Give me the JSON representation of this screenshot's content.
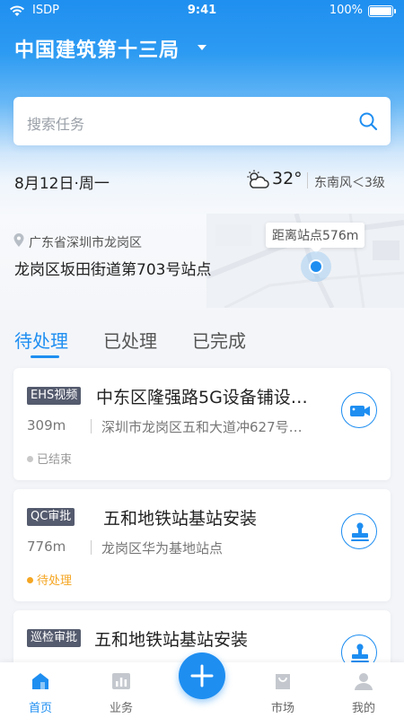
{
  "status_bar": {
    "carrier": "ISDP",
    "time": "9:41",
    "battery": "100%"
  },
  "header": {
    "org_name": "中国建筑第十三局"
  },
  "search": {
    "placeholder": "搜索任务"
  },
  "info_bar": {
    "date": "8月12日·周一",
    "temperature": "32°",
    "wind": "东南风＜3级",
    "weather_icon": "partly-cloudy-icon"
  },
  "location": {
    "region": "广东省深圳市龙岗区",
    "address": "龙岗区坂田街道第703号站点",
    "distance_label": "距离站点576m"
  },
  "tabs": [
    {
      "label": "待处理",
      "active": true
    },
    {
      "label": "已处理",
      "active": false
    },
    {
      "label": "已完成",
      "active": false
    }
  ],
  "tasks": [
    {
      "tag": "EHS视频",
      "title": "中东区隆强路5G设备铺设…",
      "distance": "309m",
      "place": "深圳市龙岗区五和大道冲627号…",
      "status": "已结束",
      "status_color": "#c8c8c8",
      "status_text_color": "#999999",
      "action_icon": "video-camera-icon"
    },
    {
      "tag": "QC审批",
      "title": "五和地铁站基站安装",
      "distance": "776m",
      "place": "龙岗区华为基地站点",
      "status": "待处理",
      "status_color": "#f5a623",
      "status_text_color": "#f5a623",
      "action_icon": "stamp-icon"
    },
    {
      "tag": "巡检审批",
      "title": "五和地铁站基站安装",
      "distance": "",
      "place": "",
      "status": "",
      "status_color": "#f5a623",
      "status_text_color": "#f5a623",
      "action_icon": "stamp-icon"
    }
  ],
  "bottom_nav": {
    "items": [
      {
        "label": "首页",
        "icon": "home-icon",
        "active": true
      },
      {
        "label": "业务",
        "icon": "chart-icon",
        "active": false
      },
      {
        "label": "市场",
        "icon": "shopping-bag-icon",
        "active": false
      },
      {
        "label": "我的",
        "icon": "user-icon",
        "active": false
      }
    ],
    "fab_icon": "plus-icon"
  },
  "colors": {
    "accent": "#1e8ef1",
    "tag_bg": "#555b6e"
  }
}
